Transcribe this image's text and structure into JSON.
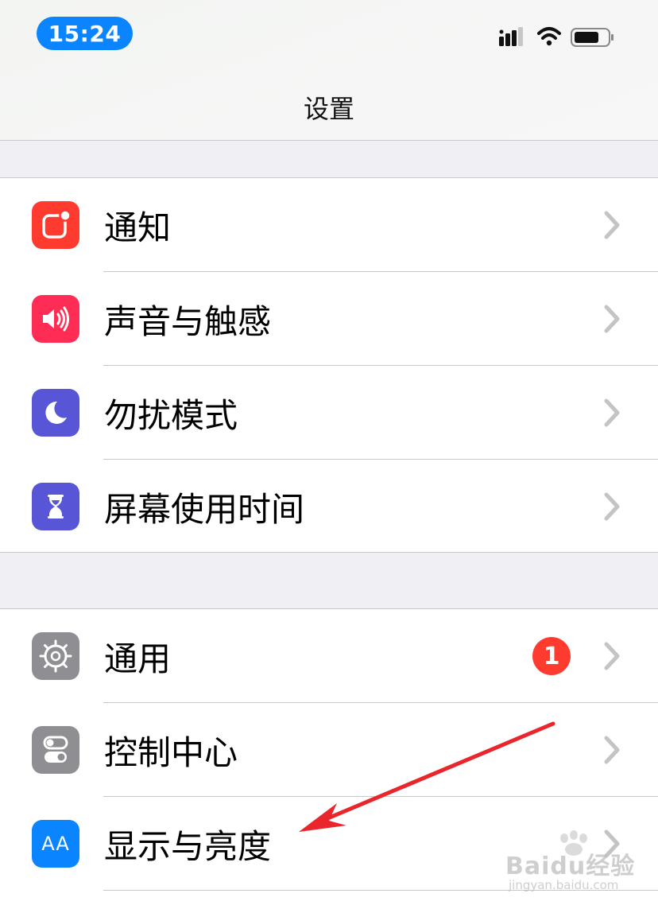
{
  "status_bar": {
    "time": "15:24",
    "icons": [
      "signal-icon",
      "wifi-icon",
      "battery-icon"
    ],
    "accent_color": "#0a84ff"
  },
  "nav": {
    "title": "设置"
  },
  "groups": [
    {
      "items": [
        {
          "label": "通知",
          "icon": "notifications-icon",
          "color": "#ff3b30"
        },
        {
          "label": "声音与触感",
          "icon": "speaker-icon",
          "color": "#ff2d55"
        },
        {
          "label": "勿扰模式",
          "icon": "moon-icon",
          "color": "#5856d6"
        },
        {
          "label": "屏幕使用时间",
          "icon": "hourglass-icon",
          "color": "#5856d6"
        }
      ]
    },
    {
      "items": [
        {
          "label": "通用",
          "icon": "gear-icon",
          "color": "#8e8e93",
          "badge": "1"
        },
        {
          "label": "控制中心",
          "icon": "toggles-icon",
          "color": "#8e8e93"
        },
        {
          "label": "显示与亮度",
          "icon": "display-aa-icon",
          "color": "#0a84ff",
          "icon_text": "AA"
        }
      ]
    }
  ],
  "annotation": {
    "type": "arrow",
    "color": "#e8262b",
    "points_to": "显示与亮度"
  },
  "watermark": {
    "brand": "Baidu经验",
    "url": "jingyan.baidu.com"
  }
}
